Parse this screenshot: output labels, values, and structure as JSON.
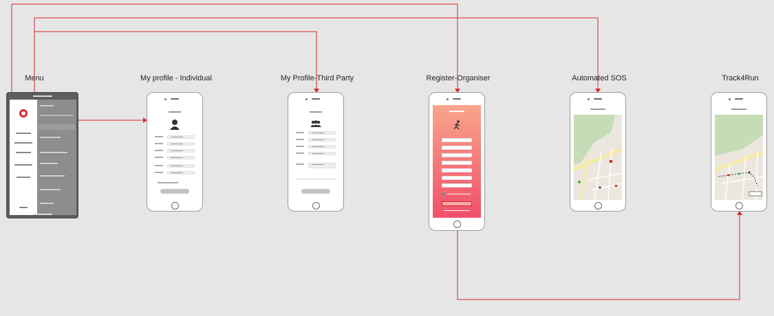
{
  "screens": [
    {
      "id": "menu",
      "label": "Menu"
    },
    {
      "id": "individual",
      "label": "My profile - Individual"
    },
    {
      "id": "third-party",
      "label": "My Profile-Third Party"
    },
    {
      "id": "organiser",
      "label": "Register-Organiser"
    },
    {
      "id": "sos",
      "label": "Automated SOS"
    },
    {
      "id": "track",
      "label": "Track4Run"
    }
  ],
  "colors": {
    "connector": "#d9262c",
    "background": "#e6e6e6",
    "gradient_top": "#f9a58b",
    "gradient_bottom": "#f1506a"
  },
  "icons": {
    "individual": "person-icon",
    "third_party": "group-icon",
    "organiser": "runner-icon",
    "map_pin": "map-pin-icon"
  }
}
